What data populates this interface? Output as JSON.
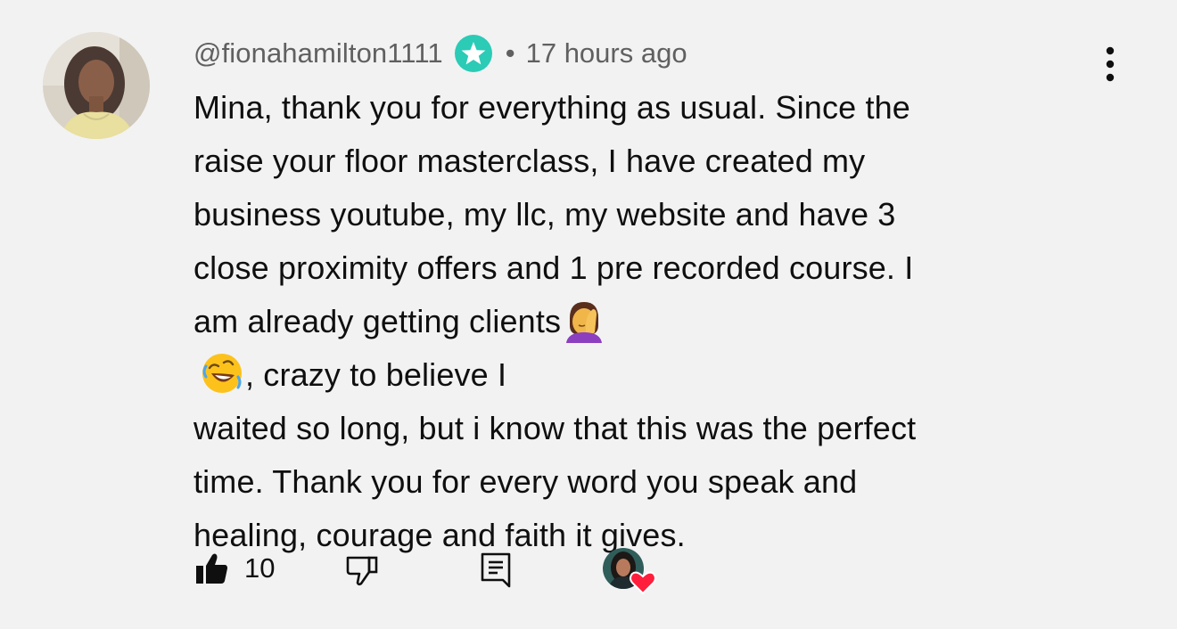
{
  "comment": {
    "author": "@fionahamilton1111",
    "separator": "•",
    "timestamp": "17 hours ago",
    "text_lines": [
      "Mina, thank you for everything as usual. Since the",
      "raise your floor masterclass, I have created my",
      "business youtube, my llc, my website and have 3",
      "close proximity offers and 1 pre recorded course. I",
      "am already getting clients",
      ", crazy to believe I",
      "waited so long, but i know that this was the perfect",
      "time. Thank you for every word you speak and",
      "healing, courage and faith it gives."
    ],
    "emojis": [
      "face-palm-emoji",
      "rolling-on-floor-laughing-emoji"
    ],
    "like_count": "10"
  },
  "colors": {
    "background": "#f2f2f2",
    "text": "#0f0f0f",
    "secondary_text": "#606060",
    "badge_teal": "#2bcbb6",
    "heart_red": "#ff1f3d"
  },
  "icons": {
    "badge": "star-badge-icon",
    "more": "more-vert-icon",
    "like": "thumbs-up-filled-icon",
    "dislike": "thumbs-down-outline-icon",
    "reply": "comment-reply-icon",
    "creator_heart": "creator-heart-icon"
  }
}
